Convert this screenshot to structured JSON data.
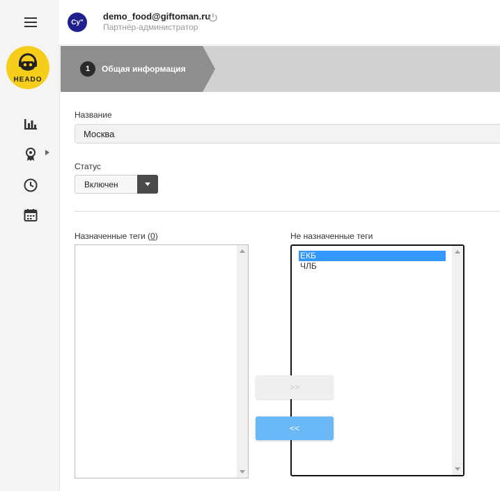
{
  "header": {
    "avatar_text": "Су\"",
    "email": "demo_food@giftoman.ru",
    "role": "Партнёр-администратор"
  },
  "sidebar": {
    "logo_text": "HEADO",
    "icons": [
      "menu-icon",
      "bar-chart-icon",
      "award-icon",
      "clock-icon",
      "calendar-icon"
    ]
  },
  "stepper": {
    "steps": [
      {
        "number": "1",
        "label": "Общая информация"
      }
    ]
  },
  "form": {
    "name_label": "Название",
    "name_value": "Москва",
    "status_label": "Статус",
    "status_value": "Включен"
  },
  "tags": {
    "assigned_label": "Назначенные теги (",
    "assigned_count": "0",
    "assigned_label_end": ")",
    "assigned_items": [],
    "unassigned_label": "Не назначенные теги",
    "unassigned_items": [
      "ЕКБ",
      "ЧЛБ"
    ],
    "unassigned_selected": "ЕКБ",
    "add_button": ">>",
    "remove_button": "<<"
  },
  "colors": {
    "sidebar_bg": "#f4f4f4",
    "logo_yellow": "#f7cd1c",
    "avatar_bg": "#1f1f8f",
    "selection": "#3399ff",
    "primary_button": "#6bb8f7"
  }
}
